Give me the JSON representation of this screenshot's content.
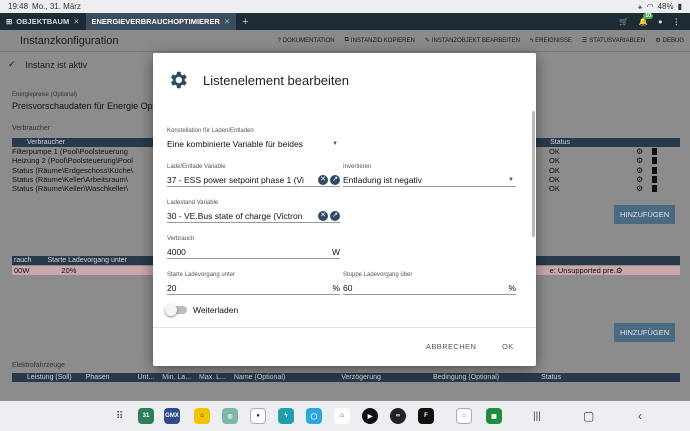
{
  "statusbar": {
    "time": "19:48",
    "date": "Mo., 31. März",
    "battery": "48%"
  },
  "tabs": [
    {
      "label": "OBJEKTBAUM",
      "close": "✕"
    },
    {
      "label": "ENERGIEVERBRAUCHOPTIMIERER",
      "close": "✕"
    }
  ],
  "tab_add": "+",
  "notif_count": "10",
  "header": {
    "title": "Instanzkonfiguration",
    "actions": [
      "DOKUMENTATION",
      "INSTANZID KOPIEREN",
      "INSTANZOBJEKT BEARBEITEN",
      "EREIGNISSE",
      "STATUSVARIABLEN",
      "DEBUG"
    ]
  },
  "instance_status": "Instanz ist aktiv",
  "bg": {
    "energy_label": "Energiepreise (Optional)",
    "energy_value": "Preisvorschaudaten für Energie Op",
    "consumers_label": "Verbraucher",
    "consumers_header": "Verbraucher",
    "status_header": "Status",
    "rows": [
      "Filterpumpe 1 (Pool\\Poolsteuerung",
      "Heizung 2 (Pool\\Poolsteuerung\\Pool",
      "Status (Räume\\Erdgeschoss\\Küche\\",
      "Status (Räume\\Keller\\Arbeitsraum\\",
      "Status (Räume\\Keller\\Waschkeller\\"
    ],
    "statuses": [
      "OK",
      "OK",
      "OK",
      "OK",
      "OK"
    ],
    "add_button": "HINZUFÜGEN",
    "batt_head": [
      "rauch",
      "Starte Ladevorgang unter"
    ],
    "batt_row": [
      "00W",
      "20%"
    ],
    "batt_status": "e: Unsupported pre...",
    "add_button2": "HINZUFÜGEN",
    "ev_label": "Elektrofahrzeuge",
    "ev_head": [
      "Leistung (Soll)",
      "Phasen",
      "Unt...",
      "Min. La...",
      "Max. L...",
      "Name (Optional)",
      "Verzögerung",
      "Bedingung (Optional)",
      "Status"
    ]
  },
  "modal": {
    "title": "Listenelement bearbeiten",
    "constellation": {
      "label": "Konstellation für Laden/Entladen",
      "value": "Eine kombinierte Variable für beides"
    },
    "charge_var": {
      "label": "Lade/Entlade Variable",
      "value": "37 - ESS power setpoint phase 1 (Vi"
    },
    "invert": {
      "label": "Invertieren",
      "value": "Entladung ist negativ"
    },
    "soc_var": {
      "label": "Ladestand Variable",
      "value": "30 - VE.Bus state of charge (Victron"
    },
    "consumption": {
      "label": "Verbrauch",
      "value": "4000",
      "unit": "W"
    },
    "start_below": {
      "label": "Starte Ladevorgang unter",
      "value": "20",
      "unit": "%"
    },
    "stop_above": {
      "label": "Stoppe Ladevorgang über",
      "value": "60",
      "unit": "%"
    },
    "recharge": {
      "label": "Weiterladen"
    },
    "cancel": "ABBRECHEN",
    "ok": "OK"
  }
}
